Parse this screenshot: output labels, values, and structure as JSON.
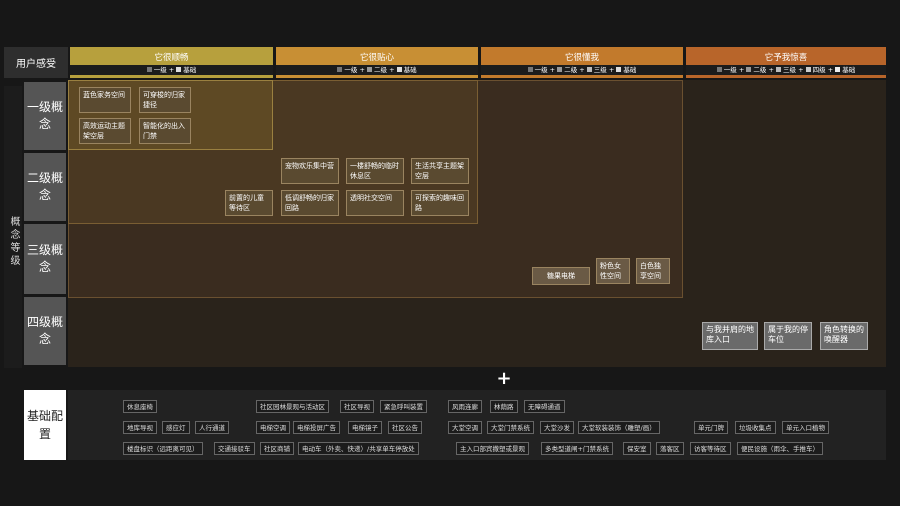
{
  "row_header": "用户感受",
  "side_label": "概念等级",
  "columns": [
    {
      "title": "它很顺畅",
      "sub": [
        "一级",
        "+",
        "基础"
      ],
      "color": "#b7a03d"
    },
    {
      "title": "它很贴心",
      "sub": [
        "一级",
        "+",
        "二级",
        "+",
        "基础"
      ],
      "color": "#c88f34"
    },
    {
      "title": "它很懂我",
      "sub": [
        "一级",
        "+",
        "二级",
        "+",
        "三级",
        "+",
        "基础"
      ],
      "color": "#c27a2c"
    },
    {
      "title": "它予我惊喜",
      "sub": [
        "一级",
        "+",
        "二级",
        "+",
        "三级",
        "+",
        "四级",
        "+",
        "基础"
      ],
      "color": "#b8652a"
    }
  ],
  "levels": [
    "一级概念",
    "二级概念",
    "三级概念",
    "四级概念"
  ],
  "level1_items": [
    "蓝色家务空间",
    "可穿梭的归家捷径",
    "高效运动主题架空层",
    "智能化的出入门禁"
  ],
  "level2_items": [
    "宠物欢乐集中营",
    "一楼舒畅的临时休息区",
    "生活共享主题架空层",
    "前置的儿童等待区",
    "低调舒畅的归家回路",
    "透明社交空间",
    "可探索的趣味回路"
  ],
  "level3_items": [
    "糖果电梯",
    "粉色女性空间",
    "白色独享空间"
  ],
  "level4_items": [
    "与我并肩的地库入口",
    "属于我的停车位",
    "角色转换的唤醒器"
  ],
  "plus": "+",
  "base_label": "基础配置",
  "base_items": [
    "休息座椅",
    "社区园林景观与活动区",
    "社区导视",
    "紧急呼叫装置",
    "风雨连廊",
    "林荫路",
    "无障碍通道",
    "地库导视",
    "感应灯",
    "人行通道",
    "电梯空调",
    "电梯投屏广告",
    "电梯镜子",
    "社区公告",
    "大堂空调",
    "大堂门禁系统",
    "大堂沙发",
    "大堂软装装饰（雕塑/画）",
    "单元门牌",
    "垃圾收集点",
    "单元入口植物",
    "楼盘标识（远距离可见）",
    "交通接驳车",
    "社区商铺",
    "电动车（外卖、快递）/共享单车停放处",
    "主入口部宾撒塑或景观",
    "多类型道闸+门禁系统",
    "保安室",
    "落客区",
    "访客等待区",
    "便民设施（雨伞、手推车）"
  ]
}
